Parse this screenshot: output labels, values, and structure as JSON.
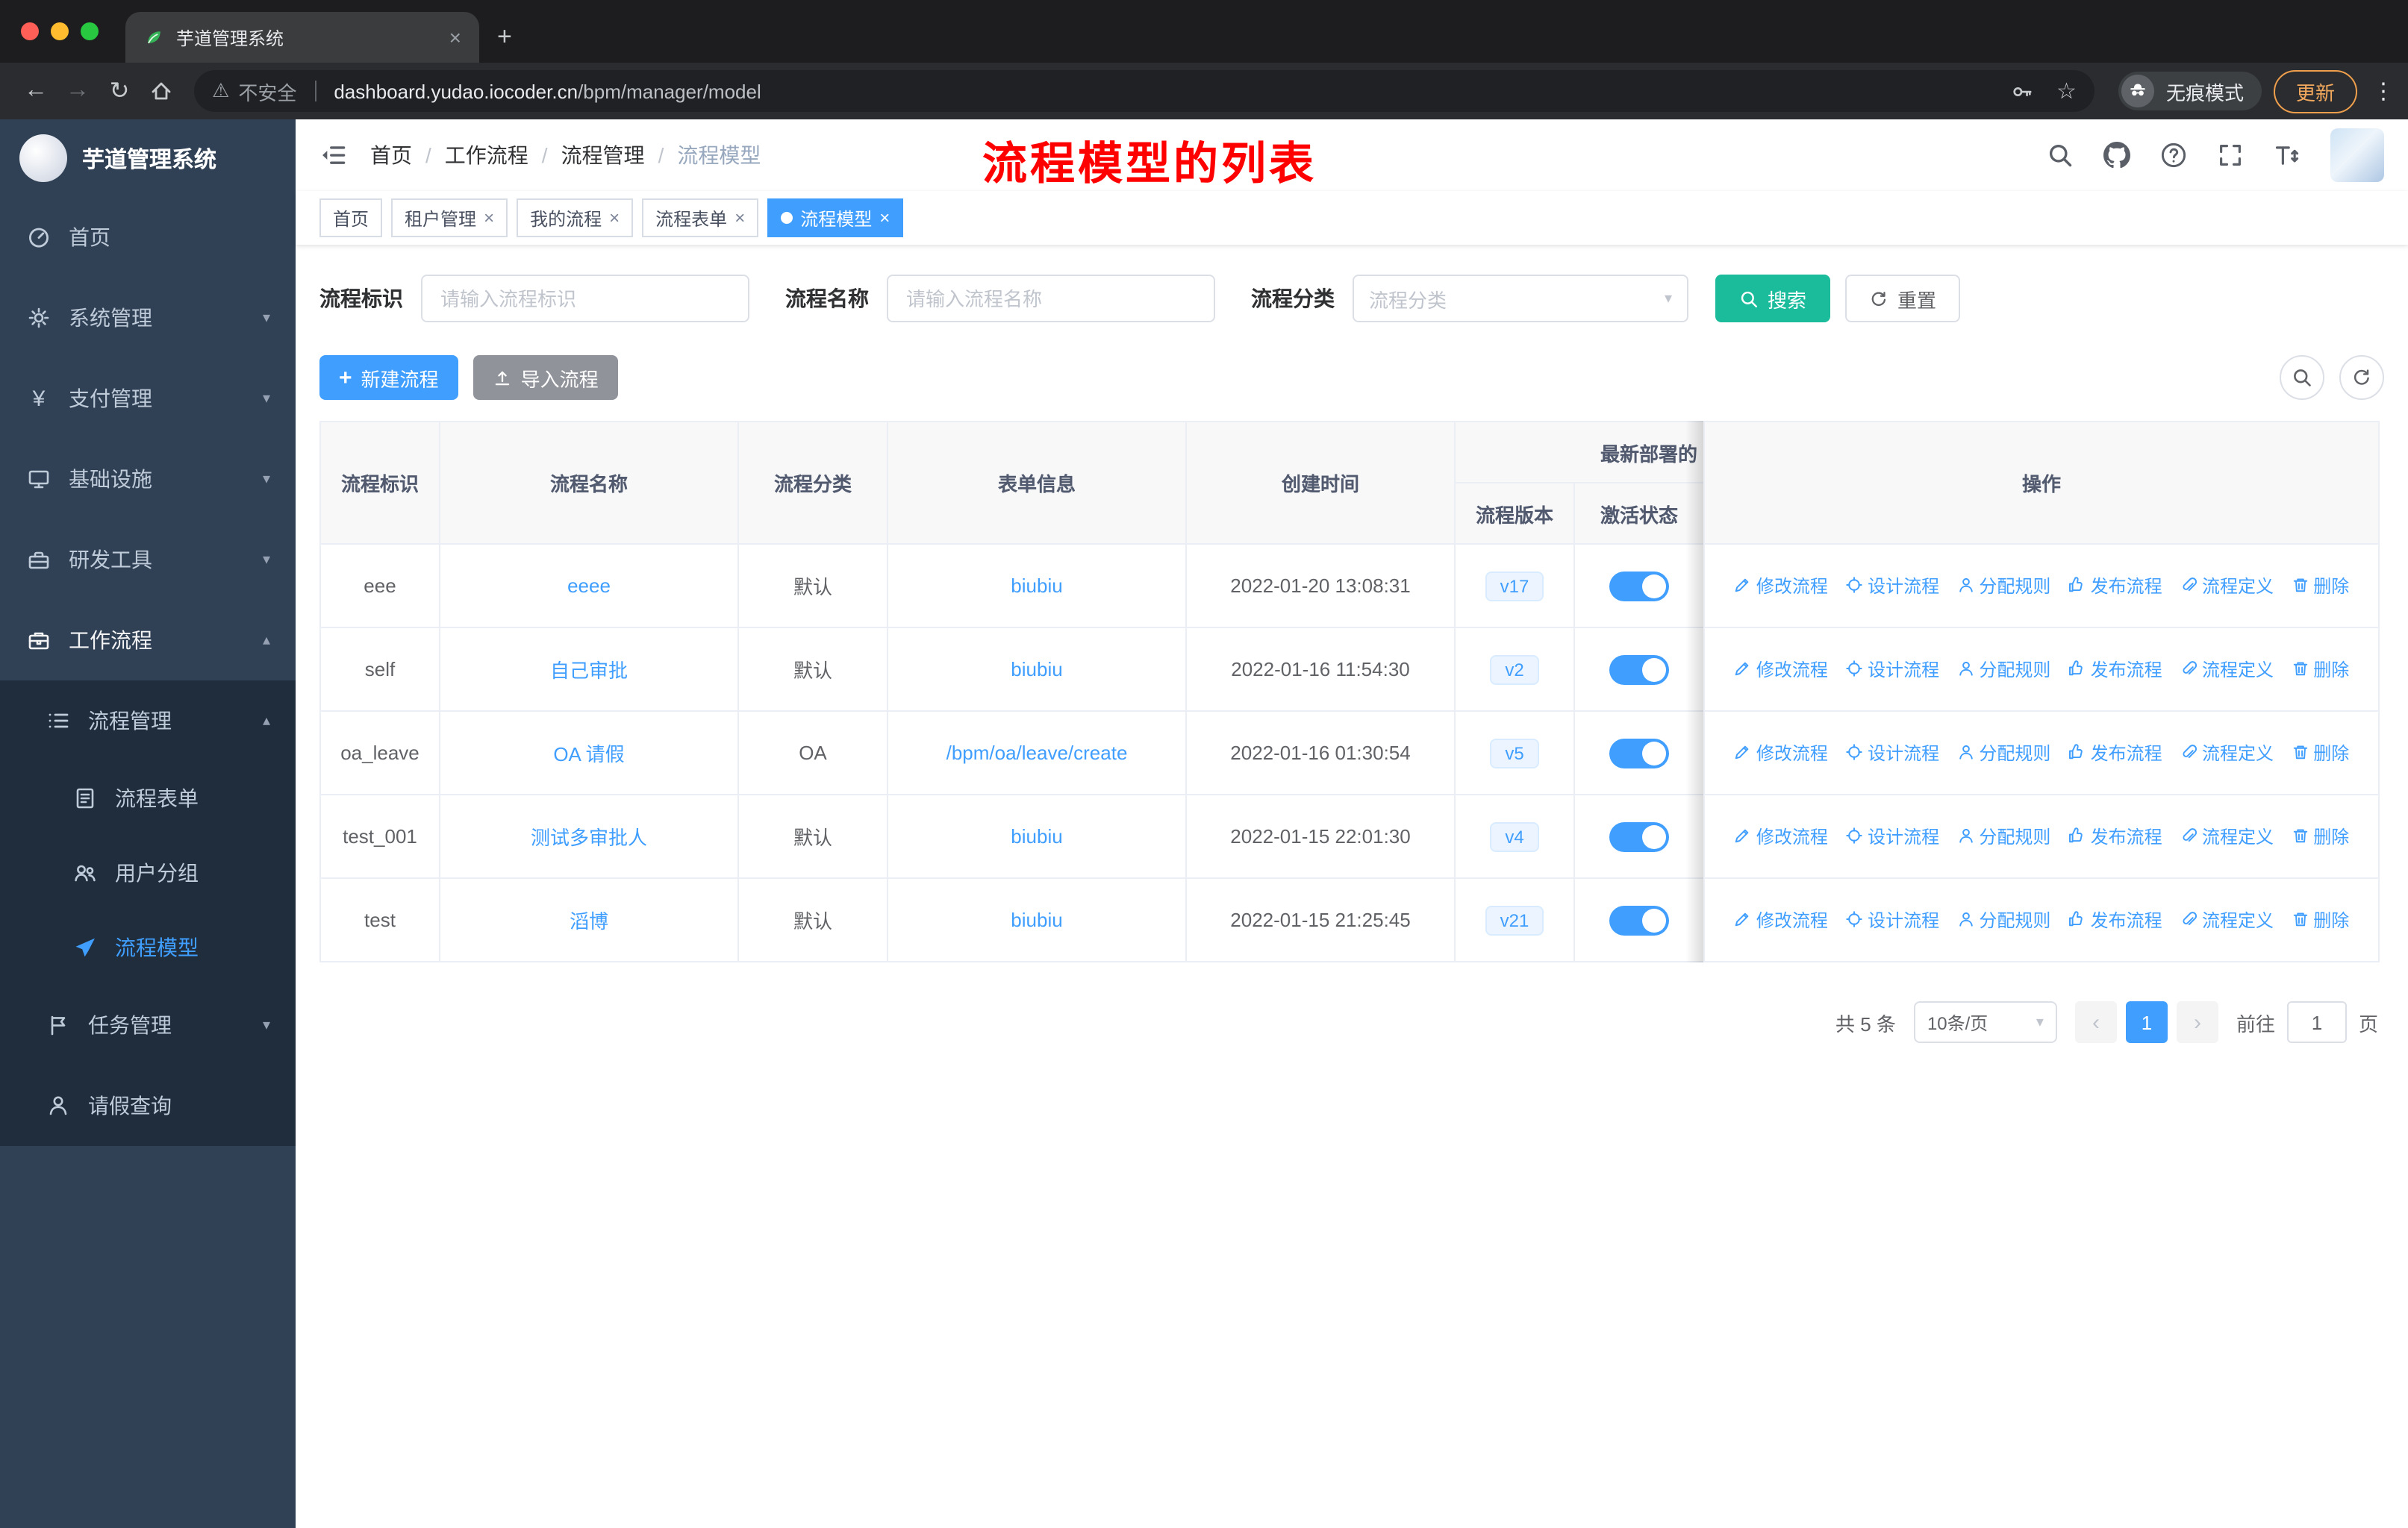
{
  "colors": {
    "primary": "#409eff",
    "search_button": "#1abc9c",
    "import_button": "#909399",
    "sidebar_bg": "#304156",
    "submenu_bg": "#1f2d3d",
    "annotation_red": "#fe0000",
    "version_tag_bg": "#ecf5ff",
    "update_button_orange": "#ef9f4c"
  },
  "icons": {
    "back": "←",
    "forward": "→",
    "reload": "↻",
    "warning": "⚠",
    "star": "☆",
    "kebab": "⋮",
    "close": "×",
    "plus": "+",
    "chevron_down": "▾",
    "chevron_up": "▴",
    "prev": "‹",
    "next": "›",
    "yen": "¥",
    "separator": "/"
  },
  "browser": {
    "tab_title": "芋道管理系统",
    "security_label": "不安全",
    "url_domain": "dashboard.yudao.iocoder.cn",
    "url_path": "/bpm/manager/model",
    "incognito_label": "无痕模式",
    "update_label": "更新"
  },
  "sidebar": {
    "logo_title": "芋道管理系统",
    "items": [
      {
        "label": "首页"
      },
      {
        "label": "系统管理",
        "expandable": true
      },
      {
        "label": "支付管理",
        "expandable": true
      },
      {
        "label": "基础设施",
        "expandable": true
      },
      {
        "label": "研发工具",
        "expandable": true
      },
      {
        "label": "工作流程",
        "expandable": true,
        "expanded": true
      },
      {
        "label": "流程管理",
        "expandable": true,
        "expanded": true
      },
      {
        "label": "流程表单"
      },
      {
        "label": "用户分组"
      },
      {
        "label": "流程模型",
        "active": true
      },
      {
        "label": "任务管理",
        "expandable": true
      },
      {
        "label": "请假查询"
      }
    ]
  },
  "header": {
    "breadcrumb": [
      "首页",
      "工作流程",
      "流程管理",
      "流程模型"
    ],
    "annotation": "流程模型的列表"
  },
  "tags": [
    {
      "label": "首页",
      "closable": false,
      "active": false
    },
    {
      "label": "租户管理",
      "closable": true,
      "active": false
    },
    {
      "label": "我的流程",
      "closable": true,
      "active": false
    },
    {
      "label": "流程表单",
      "closable": true,
      "active": false
    },
    {
      "label": "流程模型",
      "closable": true,
      "active": true
    }
  ],
  "filters": {
    "key_label": "流程标识",
    "key_placeholder": "请输入流程标识",
    "name_label": "流程名称",
    "name_placeholder": "请输入流程名称",
    "category_label": "流程分类",
    "category_placeholder": "流程分类",
    "search_label": "搜索",
    "reset_label": "重置"
  },
  "toolbar": {
    "create_label": "新建流程",
    "import_label": "导入流程"
  },
  "table": {
    "headers": {
      "key": "流程标识",
      "name": "流程名称",
      "category": "流程分类",
      "form": "表单信息",
      "created": "创建时间",
      "deploy_group": "最新部署的",
      "version": "流程版本",
      "active": "激活状态",
      "ops": "操作"
    },
    "action_labels": [
      "修改流程",
      "设计流程",
      "分配规则",
      "发布流程",
      "流程定义",
      "删除"
    ],
    "rows": [
      {
        "key": "eee",
        "name": "eeee",
        "category": "默认",
        "form": "biubiu",
        "created": "2022-01-20 13:08:31",
        "version": "v17",
        "active": true
      },
      {
        "key": "self",
        "name": "自己审批",
        "category": "默认",
        "form": "biubiu",
        "created": "2022-01-16 11:54:30",
        "version": "v2",
        "active": true
      },
      {
        "key": "oa_leave",
        "name": "OA 请假",
        "category": "OA",
        "form": "/bpm/oa/leave/create",
        "created": "2022-01-16 01:30:54",
        "version": "v5",
        "active": true
      },
      {
        "key": "test_001",
        "name": "测试多审批人",
        "category": "默认",
        "form": "biubiu",
        "created": "2022-01-15 22:01:30",
        "version": "v4",
        "active": true
      },
      {
        "key": "test",
        "name": "滔博",
        "category": "默认",
        "form": "biubiu",
        "created": "2022-01-15 21:25:45",
        "version": "v21",
        "active": true
      }
    ]
  },
  "pagination": {
    "total": "共 5 条",
    "page_size": "10条/页",
    "page": "1",
    "goto_label": "前往",
    "goto_value": "1",
    "unit_label": "页"
  }
}
